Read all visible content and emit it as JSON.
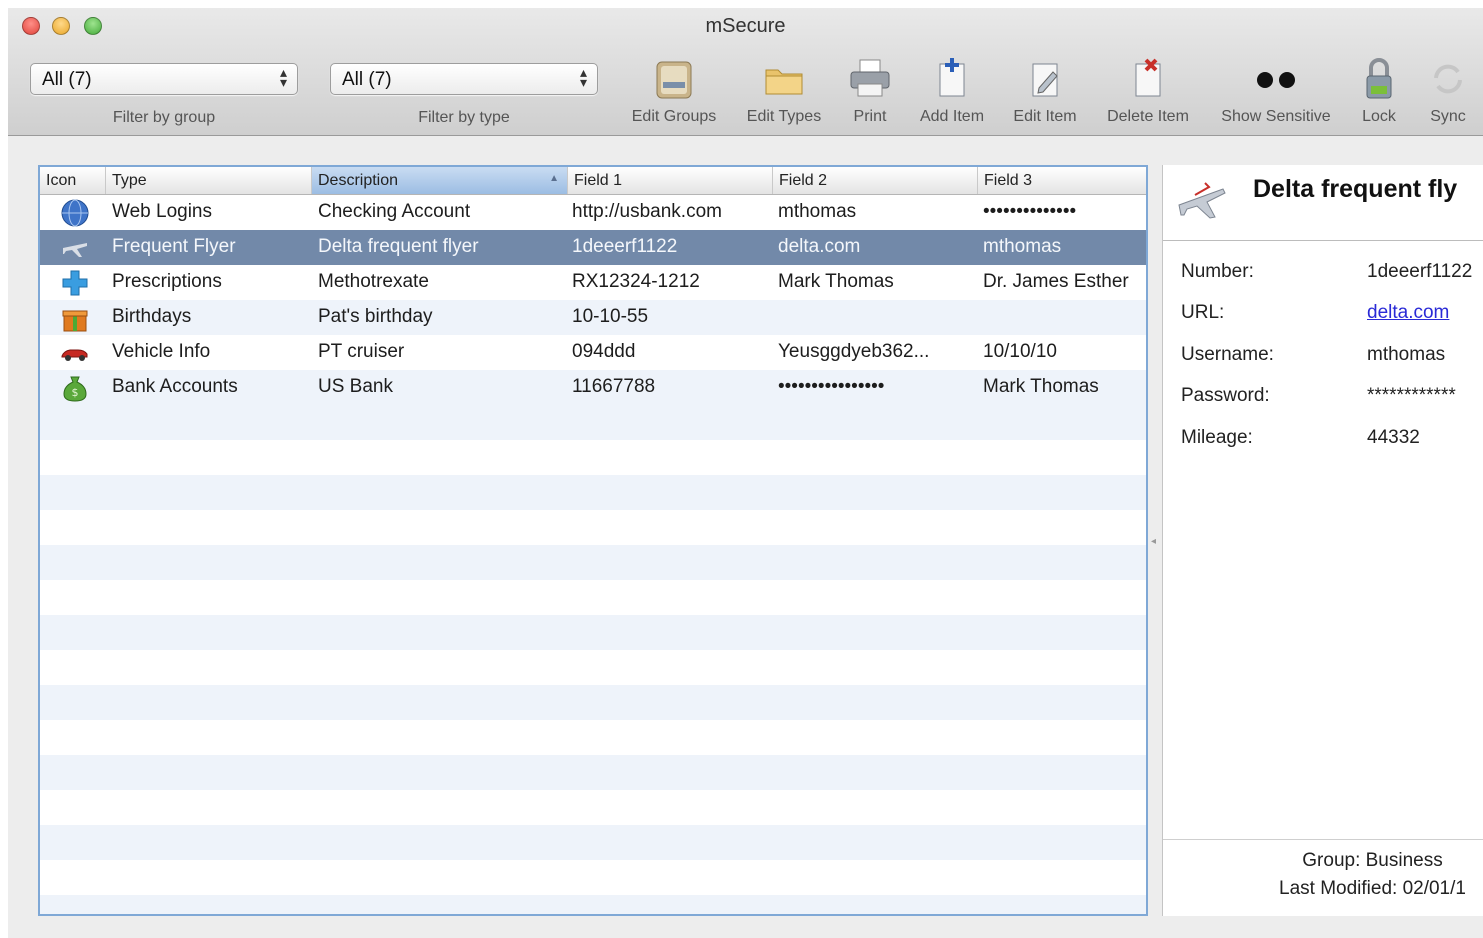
{
  "window": {
    "title": "mSecure"
  },
  "toolbar": {
    "group_filter": {
      "value": "All (7)",
      "label": "Filter by group"
    },
    "type_filter": {
      "value": "All (7)",
      "label": "Filter by type"
    },
    "buttons": [
      {
        "label": "Edit Groups",
        "icon": "folder-card-icon"
      },
      {
        "label": "Edit Types",
        "icon": "folder-icon"
      },
      {
        "label": "Print",
        "icon": "printer-icon"
      },
      {
        "label": "Add Item",
        "icon": "add-document-icon"
      },
      {
        "label": "Edit Item",
        "icon": "edit-document-icon"
      },
      {
        "label": "Delete Item",
        "icon": "delete-document-icon"
      },
      {
        "label": "Show Sensitive",
        "icon": "dots-icon"
      },
      {
        "label": "Lock",
        "icon": "lock-icon"
      },
      {
        "label": "Sync",
        "icon": "sync-icon"
      }
    ]
  },
  "table": {
    "columns": [
      "Icon",
      "Type",
      "Description",
      "Field 1",
      "Field 2",
      "Field 3"
    ],
    "sorted_column": "Description",
    "rows": [
      {
        "icon": "globe-icon",
        "type": "Web Logins",
        "description": "Checking Account",
        "field1": "http://usbank.com",
        "field2": "mthomas",
        "field3": "••••••••••••••",
        "selected": false
      },
      {
        "icon": "airplane-icon",
        "type": "Frequent Flyer",
        "description": "Delta frequent flyer",
        "field1": "1deeerf1122",
        "field2": "delta.com",
        "field3": "mthomas",
        "selected": true
      },
      {
        "icon": "medical-icon",
        "type": "Prescriptions",
        "description": "Methotrexate",
        "field1": "RX12324-1212",
        "field2": "Mark Thomas",
        "field3": "Dr. James Esther",
        "selected": false
      },
      {
        "icon": "gift-icon",
        "type": "Birthdays",
        "description": "Pat's birthday",
        "field1": "10-10-55",
        "field2": "",
        "field3": "",
        "selected": false
      },
      {
        "icon": "car-icon",
        "type": "Vehicle Info",
        "description": "PT cruiser",
        "field1": "094ddd",
        "field2": "Yeusggdyeb362...",
        "field3": "10/10/10",
        "selected": false
      },
      {
        "icon": "money-bag-icon",
        "type": "Bank Accounts",
        "description": "US Bank",
        "field1": "11667788",
        "field2": "••••••••••••••••",
        "field3": "Mark Thomas",
        "selected": false
      }
    ]
  },
  "detail": {
    "title": "Delta frequent fly",
    "icon": "airplane-icon",
    "fields": [
      {
        "label": "Number:",
        "value": "1deeerf1122",
        "link": false
      },
      {
        "label": "URL:",
        "value": "delta.com",
        "link": true
      },
      {
        "label": "Username:",
        "value": "mthomas",
        "link": false
      },
      {
        "label": "Password:",
        "value": "************",
        "link": false
      },
      {
        "label": "Mileage:",
        "value": "44332",
        "link": false
      }
    ],
    "group": "Group: Business",
    "last_modified": "Last Modified: 02/01/1"
  },
  "colors": {
    "selection": "#7289a9",
    "table_border": "#7fa8d6",
    "link": "#2a2ad6",
    "stripe": "#eef3fa"
  }
}
